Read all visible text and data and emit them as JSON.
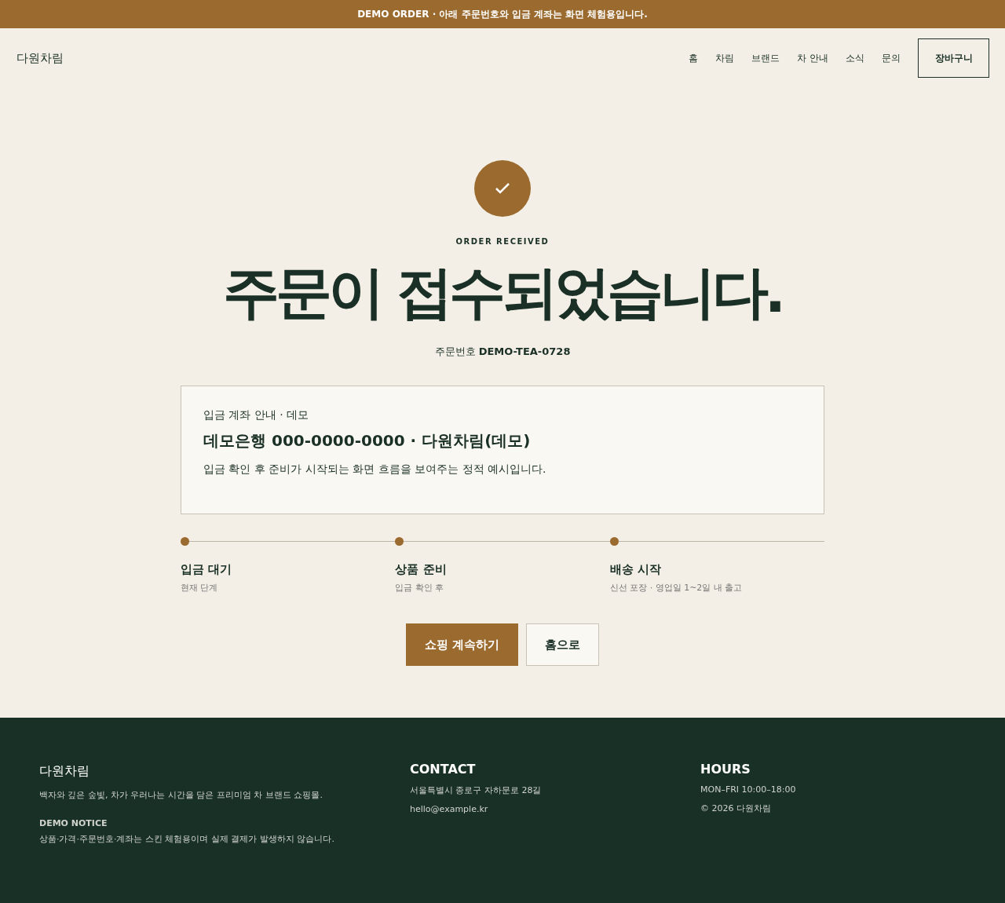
{
  "banner": {
    "text": "DEMO ORDER · 아래 주문번호와 입금 계좌는 화면 체험용입니다."
  },
  "header": {
    "logo": "다원차림",
    "nav": [
      "홈",
      "차림",
      "브랜드",
      "차 안내",
      "소식",
      "문의"
    ],
    "cart": "장바구니"
  },
  "hero": {
    "eyebrow": "ORDER RECEIVED",
    "title": "주문이 접수되었습니다.",
    "order_label": "주문번호",
    "order_number": "DEMO-TEA-0728"
  },
  "account": {
    "label": "입금 계좌 안내 · 데모",
    "account": "데모은행 000-0000-0000 · 다원차림(데모)",
    "note": "입금 확인 후 준비가 시작되는 화면 흐름을 보여주는 정적 예시입니다."
  },
  "steps": [
    {
      "title": "입금 대기",
      "sub": "현재 단계"
    },
    {
      "title": "상품 준비",
      "sub": "입금 확인 후"
    },
    {
      "title": "배송 시작",
      "sub": "신선 포장 · 영업일 1~2일 내 출고"
    }
  ],
  "buttons": [
    {
      "label": "쇼핑 계속하기",
      "kind": "primary"
    },
    {
      "label": "홈으로",
      "kind": "secondary"
    }
  ],
  "footer": {
    "brand": "다원차림",
    "tagline": "백자와 깊은 숲빛, 차가 우러나는 시간을 담은 프리미엄 차 브랜드 쇼핑몰.",
    "notice_title": "DEMO NOTICE",
    "notice": "상품·가격·주문번호·계좌는 스킨 체험용이며 실제 결제가 발생하지 않습니다.",
    "columns": [
      {
        "title": "CONTACT",
        "lines": [
          "서울특별시 종로구 자하문로 28길",
          "hello@example.kr"
        ]
      },
      {
        "title": "HOURS",
        "lines": [
          "MON–FRI 10:00–18:00",
          "© 2026 다원차림"
        ]
      }
    ]
  }
}
